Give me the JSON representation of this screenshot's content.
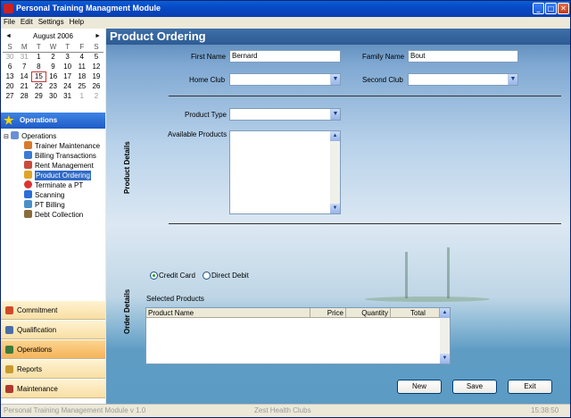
{
  "window": {
    "title": "Personal Training Managment Module"
  },
  "menu": [
    "File",
    "Edit",
    "Settings",
    "Help"
  ],
  "calendar": {
    "month_label": "August 2006",
    "prev": "◄",
    "next": "►",
    "dow": [
      "S",
      "M",
      "T",
      "W",
      "T",
      "F",
      "S"
    ],
    "weeks": [
      [
        "30",
        "31",
        "1",
        "2",
        "3",
        "4",
        "5"
      ],
      [
        "6",
        "7",
        "8",
        "9",
        "10",
        "11",
        "12"
      ],
      [
        "13",
        "14",
        "15",
        "16",
        "17",
        "18",
        "19"
      ],
      [
        "20",
        "21",
        "22",
        "23",
        "24",
        "25",
        "26"
      ],
      [
        "27",
        "28",
        "29",
        "30",
        "31",
        "1",
        "2"
      ]
    ]
  },
  "sidebar": {
    "header": "Operations",
    "tree_root": "Operations",
    "tree_items": [
      "Trainer Maintenance",
      "Billing Transactions",
      "Rent Management",
      "Product Ordering",
      "Terminate a PT",
      "Scanning",
      "PT Billing",
      "Debt Collection"
    ],
    "nav_buttons": [
      "Commitment",
      "Qualification",
      "Operations",
      "Reports",
      "Maintenance"
    ]
  },
  "main": {
    "title": "Product Ordering",
    "product_details_label": "Product Details",
    "order_details_label": "Order Details",
    "first_name_label": "First Name",
    "first_name_value": "Bernard",
    "family_name_label": "Family Name",
    "family_name_value": "Bout",
    "home_club_label": "Home Club",
    "second_club_label": "Second Club",
    "product_type_label": "Product Type",
    "available_products_label": "Available Products",
    "credit_card_label": "Credit Card",
    "direct_debit_label": "Direct Debit",
    "selected_products_label": "Selected Products",
    "columns": [
      "Product Name",
      "Price",
      "Quantity",
      "Total"
    ],
    "buttons": {
      "new": "New",
      "save": "Save",
      "exit": "Exit"
    }
  },
  "status": {
    "left": "Personal Training Management Module  v 1.0",
    "center": "Zest Health Clubs",
    "right": "15:38:50"
  }
}
